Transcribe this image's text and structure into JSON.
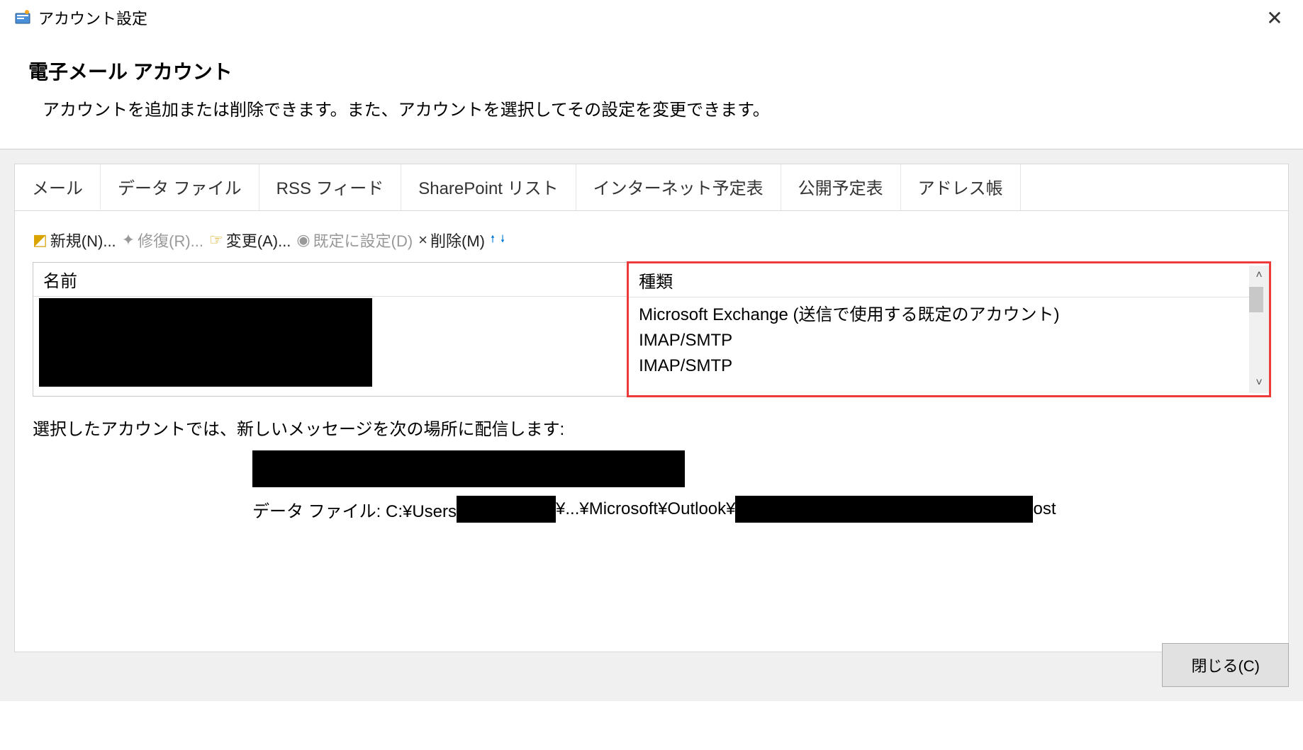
{
  "titlebar": {
    "title": "アカウント設定"
  },
  "header": {
    "title": "電子メール アカウント",
    "description": "アカウントを追加または削除できます。また、アカウントを選択してその設定を変更できます。"
  },
  "tabs": [
    {
      "label": "メール",
      "active": true
    },
    {
      "label": "データ ファイル",
      "active": false
    },
    {
      "label": "RSS フィード",
      "active": false
    },
    {
      "label": "SharePoint リスト",
      "active": false
    },
    {
      "label": "インターネット予定表",
      "active": false
    },
    {
      "label": "公開予定表",
      "active": false
    },
    {
      "label": "アドレス帳",
      "active": false
    }
  ],
  "toolbar": {
    "new": "新規(N)...",
    "repair": "修復(R)...",
    "change": "変更(A)...",
    "set_default": "既定に設定(D)",
    "delete": "削除(M)"
  },
  "table": {
    "columns": {
      "name": "名前",
      "type": "種類"
    },
    "rows": [
      {
        "name": "[REDACTED]",
        "type": "Microsoft Exchange (送信で使用する既定のアカウント)"
      },
      {
        "name": "[REDACTED]",
        "type": "IMAP/SMTP"
      },
      {
        "name": "[REDACTED]",
        "type": "IMAP/SMTP"
      }
    ]
  },
  "delivery": {
    "label": "選択したアカウントでは、新しいメッセージを次の場所に配信します:",
    "data_file_prefix": "データ ファイル: C:¥Users",
    "data_file_middle": "¥...¥Microsoft¥Outlook¥",
    "data_file_suffix": "ost"
  },
  "footer": {
    "close": "閉じる(C)"
  }
}
